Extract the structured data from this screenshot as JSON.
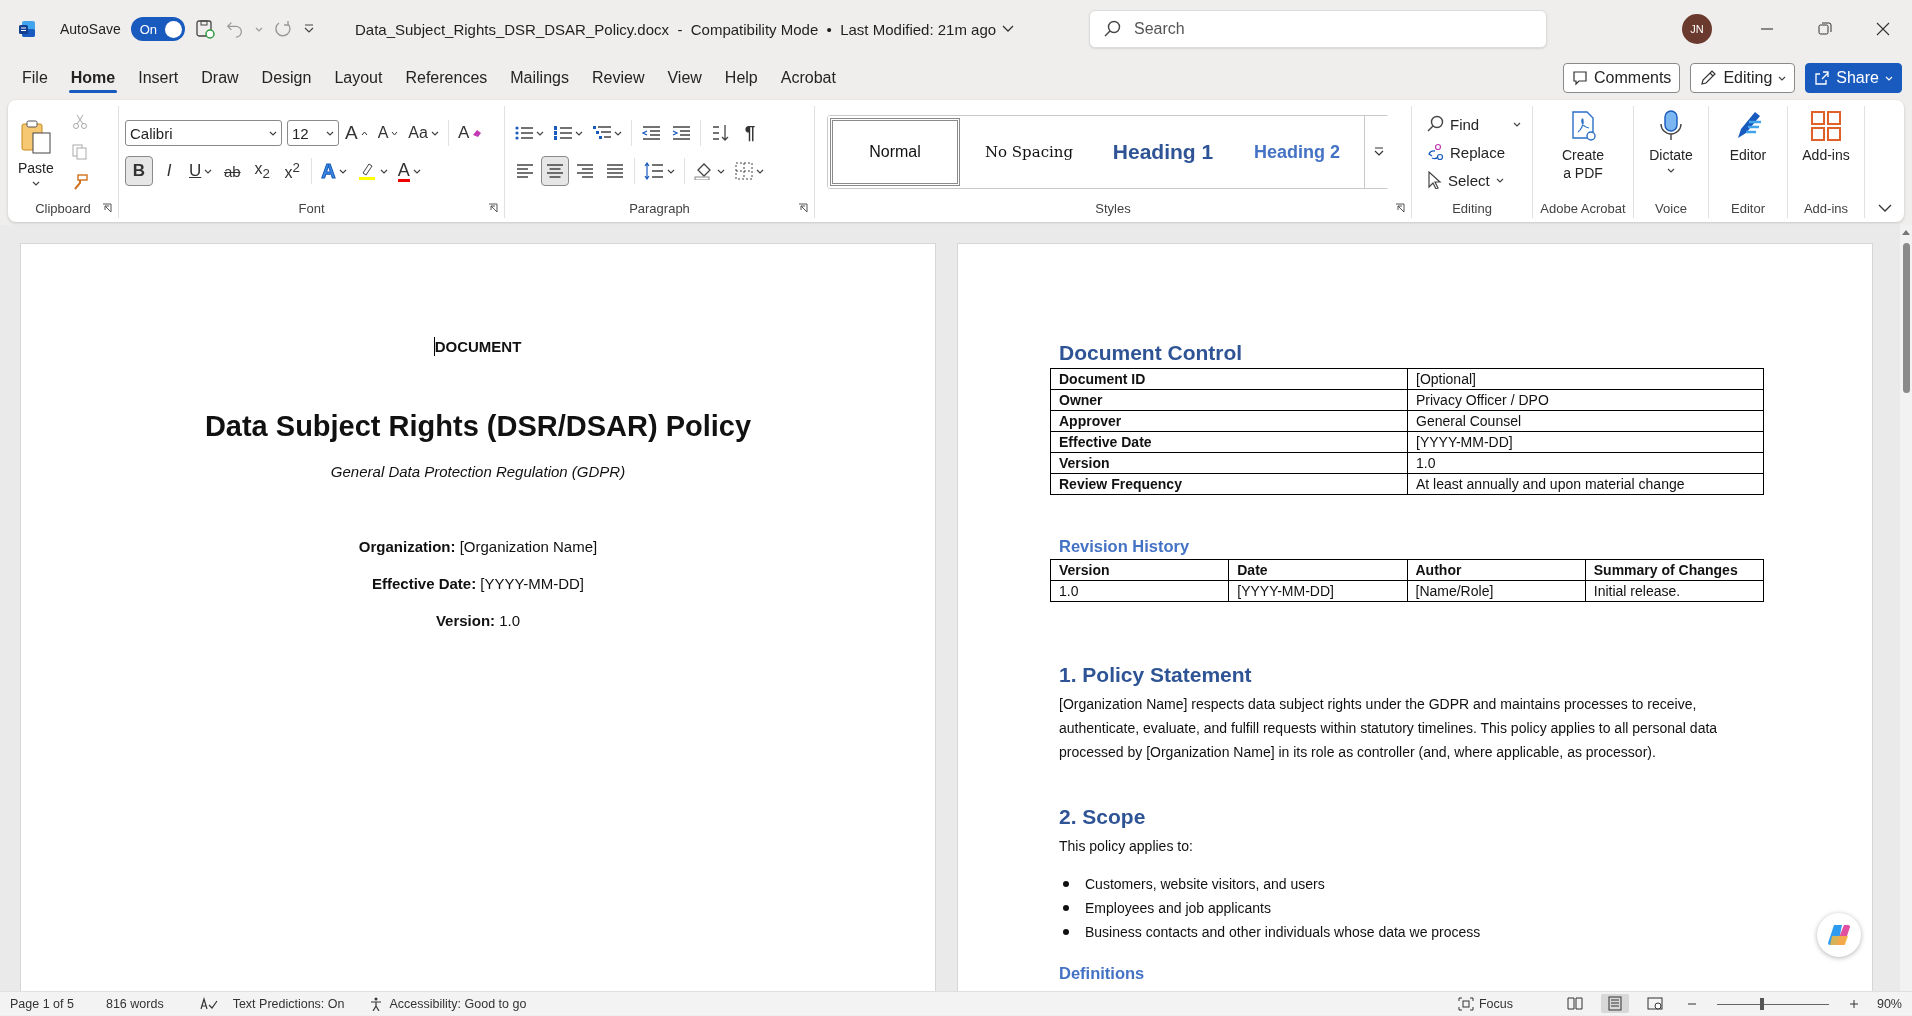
{
  "title_bar": {
    "autosave": {
      "label": "AutoSave",
      "toggle": "On",
      "on": true
    },
    "document_title": "Data_Subject_Rights_DSR_DSAR_Policy.docx  -  Compatibility Mode  •  Last Modified: 21m ago",
    "search": {
      "placeholder": "Search"
    },
    "avatar": "JN"
  },
  "tabs": [
    {
      "label": "File",
      "selected": false
    },
    {
      "label": "Home",
      "selected": true
    },
    {
      "label": "Insert",
      "selected": false
    },
    {
      "label": "Draw",
      "selected": false
    },
    {
      "label": "Design",
      "selected": false
    },
    {
      "label": "Layout",
      "selected": false
    },
    {
      "label": "References",
      "selected": false
    },
    {
      "label": "Mailings",
      "selected": false
    },
    {
      "label": "Review",
      "selected": false
    },
    {
      "label": "View",
      "selected": false
    },
    {
      "label": "Help",
      "selected": false
    },
    {
      "label": "Acrobat",
      "selected": false
    }
  ],
  "actions": {
    "comments": "Comments",
    "editing": "Editing",
    "share": "Share"
  },
  "ribbon": {
    "clipboard": {
      "paste": "Paste",
      "label": "Clipboard"
    },
    "font": {
      "name": "Calibri",
      "size": "12",
      "label": "Font",
      "tools": [
        {
          "kind": "grow",
          "glyph": "A"
        },
        {
          "kind": "shrink",
          "glyph": "A"
        },
        {
          "kind": "case",
          "glyph": "Aa"
        },
        {
          "kind": "clear",
          "glyph": "A"
        }
      ],
      "format": [
        {
          "kind": "bold",
          "glyph": "B",
          "selected": true
        },
        {
          "kind": "italic",
          "glyph": "I",
          "selected": false
        },
        {
          "kind": "underline",
          "glyph": "U",
          "selected": false
        },
        {
          "kind": "strike",
          "glyph": "ab",
          "selected": false
        },
        {
          "kind": "sub",
          "glyph": "x$_{2}$",
          "selected": false
        },
        {
          "kind": "sup",
          "glyph": "x$^{2}$",
          "selected": false
        }
      ],
      "effects": [
        {
          "kind": "effects",
          "glyph": "A"
        },
        {
          "kind": "highlight"
        },
        {
          "kind": "color",
          "glyph": "A"
        }
      ]
    },
    "paragraph": {
      "label": "Paragraph",
      "show_marks": "¶",
      "alignment": [
        {
          "kind": "left",
          "selected": false
        },
        {
          "kind": "center",
          "selected": true
        },
        {
          "kind": "right",
          "selected": false
        },
        {
          "kind": "justify",
          "selected": false
        }
      ]
    },
    "styles": {
      "label": "Styles",
      "items": [
        {
          "label": "Normal",
          "kind": "normal",
          "selected": true
        },
        {
          "label": "No Spacing",
          "kind": "nospacing",
          "selected": false
        },
        {
          "label": "Heading 1",
          "kind": "heading1",
          "selected": false
        },
        {
          "label": "Heading 2",
          "kind": "heading2",
          "selected": false
        }
      ]
    },
    "editing": {
      "label": "Editing",
      "find": "Find",
      "replace": "Replace",
      "select": "Select"
    },
    "big_buttons": [
      {
        "kind": "pdf",
        "label": "Create\na PDF",
        "group": "Adobe Acrobat"
      },
      {
        "kind": "dictate",
        "label": "Dictate",
        "group": "Voice"
      },
      {
        "kind": "editor",
        "label": "Editor",
        "group": "Editor"
      },
      {
        "kind": "addins",
        "label": "Add-ins",
        "group": "Add-ins"
      }
    ]
  },
  "left_page": {
    "kicker": "DOCUMENT",
    "title": "Data Subject Rights (DSR/DSAR) Policy",
    "subtitle": "General Data Protection Regulation (GDPR)",
    "fields": [
      "**Organization:** [Organization Name]",
      "**Effective Date:** [YYYY-MM-DD]",
      "**Version:** 1.0"
    ]
  },
  "right_page": {
    "blocks": [
      {
        "kind": "h1",
        "text": "Document Control"
      },
      {
        "kind": "kv_table",
        "rows": [
          {
            "field": "Document ID",
            "value": "[Optional]"
          },
          {
            "field": "Owner",
            "value": "Privacy Officer / DPO"
          },
          {
            "field": "Approver",
            "value": "General Counsel"
          },
          {
            "field": "Effective Date",
            "value": "[YYYY-MM-DD]"
          },
          {
            "field": "Version",
            "value": "1.0"
          },
          {
            "field": "Review Frequency",
            "value": "At least annually and upon material change"
          }
        ]
      },
      {
        "kind": "h2",
        "text": "Revision History"
      },
      {
        "kind": "table",
        "columns": [
          "Version",
          "Date",
          "Author",
          "Summary of Changes"
        ],
        "rows": [
          [
            "1.0",
            "[YYYY-MM-DD]",
            "[Name/Role]",
            "Initial release."
          ]
        ]
      },
      {
        "kind": "h1",
        "text": "1. Policy Statement"
      },
      {
        "kind": "p",
        "text": "[Organization Name] respects data subject rights under the GDPR and maintains processes to receive, authenticate, evaluate, and fulfill requests within statutory timelines. This policy applies to all personal data processed by [Organization Name] in its role as controller (and, where applicable, as processor)."
      },
      {
        "kind": "h1",
        "text": "2. Scope"
      },
      {
        "kind": "p",
        "text": "This policy applies to:"
      },
      {
        "kind": "bullets",
        "items": [
          "Customers, website visitors, and users",
          "Employees and job applicants",
          "Business contacts and other individuals whose data we process"
        ]
      },
      {
        "kind": "h2",
        "text": "Definitions"
      }
    ]
  },
  "status_bar": {
    "page": "Page 1 of 5",
    "words": "816 words",
    "predictions": "Text Predictions: On",
    "accessibility": "Accessibility: Good to go",
    "focus": "Focus",
    "views": [
      {
        "kind": "read",
        "selected": false
      },
      {
        "kind": "print",
        "selected": true
      },
      {
        "kind": "web",
        "selected": false
      }
    ],
    "zoom": {
      "level": 0.4,
      "reading": "90%"
    }
  }
}
